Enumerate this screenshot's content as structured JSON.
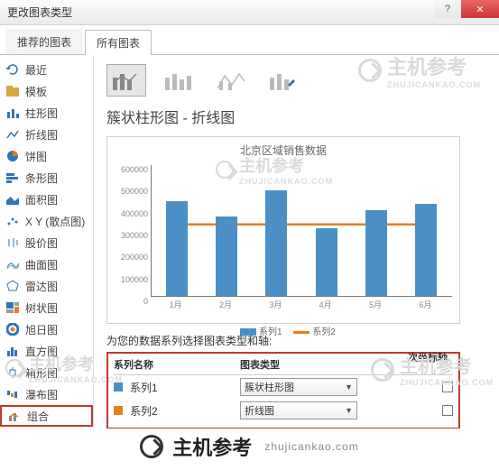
{
  "window": {
    "title": "更改图表类型"
  },
  "tabs": {
    "recommended": "推荐的图表",
    "all": "所有图表"
  },
  "sidebar": {
    "items": [
      {
        "label": "最近",
        "icon": "recent"
      },
      {
        "label": "模板",
        "icon": "template"
      },
      {
        "label": "柱形图",
        "icon": "column"
      },
      {
        "label": "折线图",
        "icon": "line"
      },
      {
        "label": "饼图",
        "icon": "pie"
      },
      {
        "label": "条形图",
        "icon": "bar"
      },
      {
        "label": "面积图",
        "icon": "area"
      },
      {
        "label": "X Y (散点图)",
        "icon": "scatter"
      },
      {
        "label": "股价图",
        "icon": "stock"
      },
      {
        "label": "曲面图",
        "icon": "surface"
      },
      {
        "label": "雷达图",
        "icon": "radar"
      },
      {
        "label": "树状图",
        "icon": "treemap"
      },
      {
        "label": "旭日图",
        "icon": "sunburst"
      },
      {
        "label": "直方图",
        "icon": "histogram"
      },
      {
        "label": "箱形图",
        "icon": "box"
      },
      {
        "label": "瀑布图",
        "icon": "waterfall"
      },
      {
        "label": "组合",
        "icon": "combo"
      }
    ]
  },
  "subtitle": "簇状柱形图 - 折线图",
  "series_caption": "为您的数据系列选择图表类型和轴:",
  "series_table": {
    "head_name": "系列名称",
    "head_type": "图表类型",
    "head_axis": "次坐标轴",
    "rows": [
      {
        "name": "系列1",
        "type": "簇状柱形图",
        "color": "#4a90c6",
        "secondary": false
      },
      {
        "name": "系列2",
        "type": "折线图",
        "color": "#e67e22",
        "secondary": false
      }
    ]
  },
  "chart_data": {
    "type": "combo",
    "title": "北京区域销售数据",
    "categories": [
      "1月",
      "2月",
      "3月",
      "4月",
      "5月",
      "6月"
    ],
    "ylim": [
      0,
      600000
    ],
    "yticks": [
      0,
      100000,
      200000,
      300000,
      400000,
      500000,
      600000
    ],
    "series": [
      {
        "name": "系列1",
        "type": "bar",
        "color": "#4a90c6",
        "values": [
          430000,
          360000,
          480000,
          310000,
          390000,
          420000
        ]
      },
      {
        "name": "系列2",
        "type": "line",
        "color": "#e67e22",
        "values": [
          330000,
          330000,
          330000,
          330000,
          330000,
          330000
        ]
      }
    ],
    "legend": [
      "系列1",
      "系列2"
    ]
  },
  "brand": {
    "name": "主机参考",
    "domain": "zhujicankao.com"
  }
}
